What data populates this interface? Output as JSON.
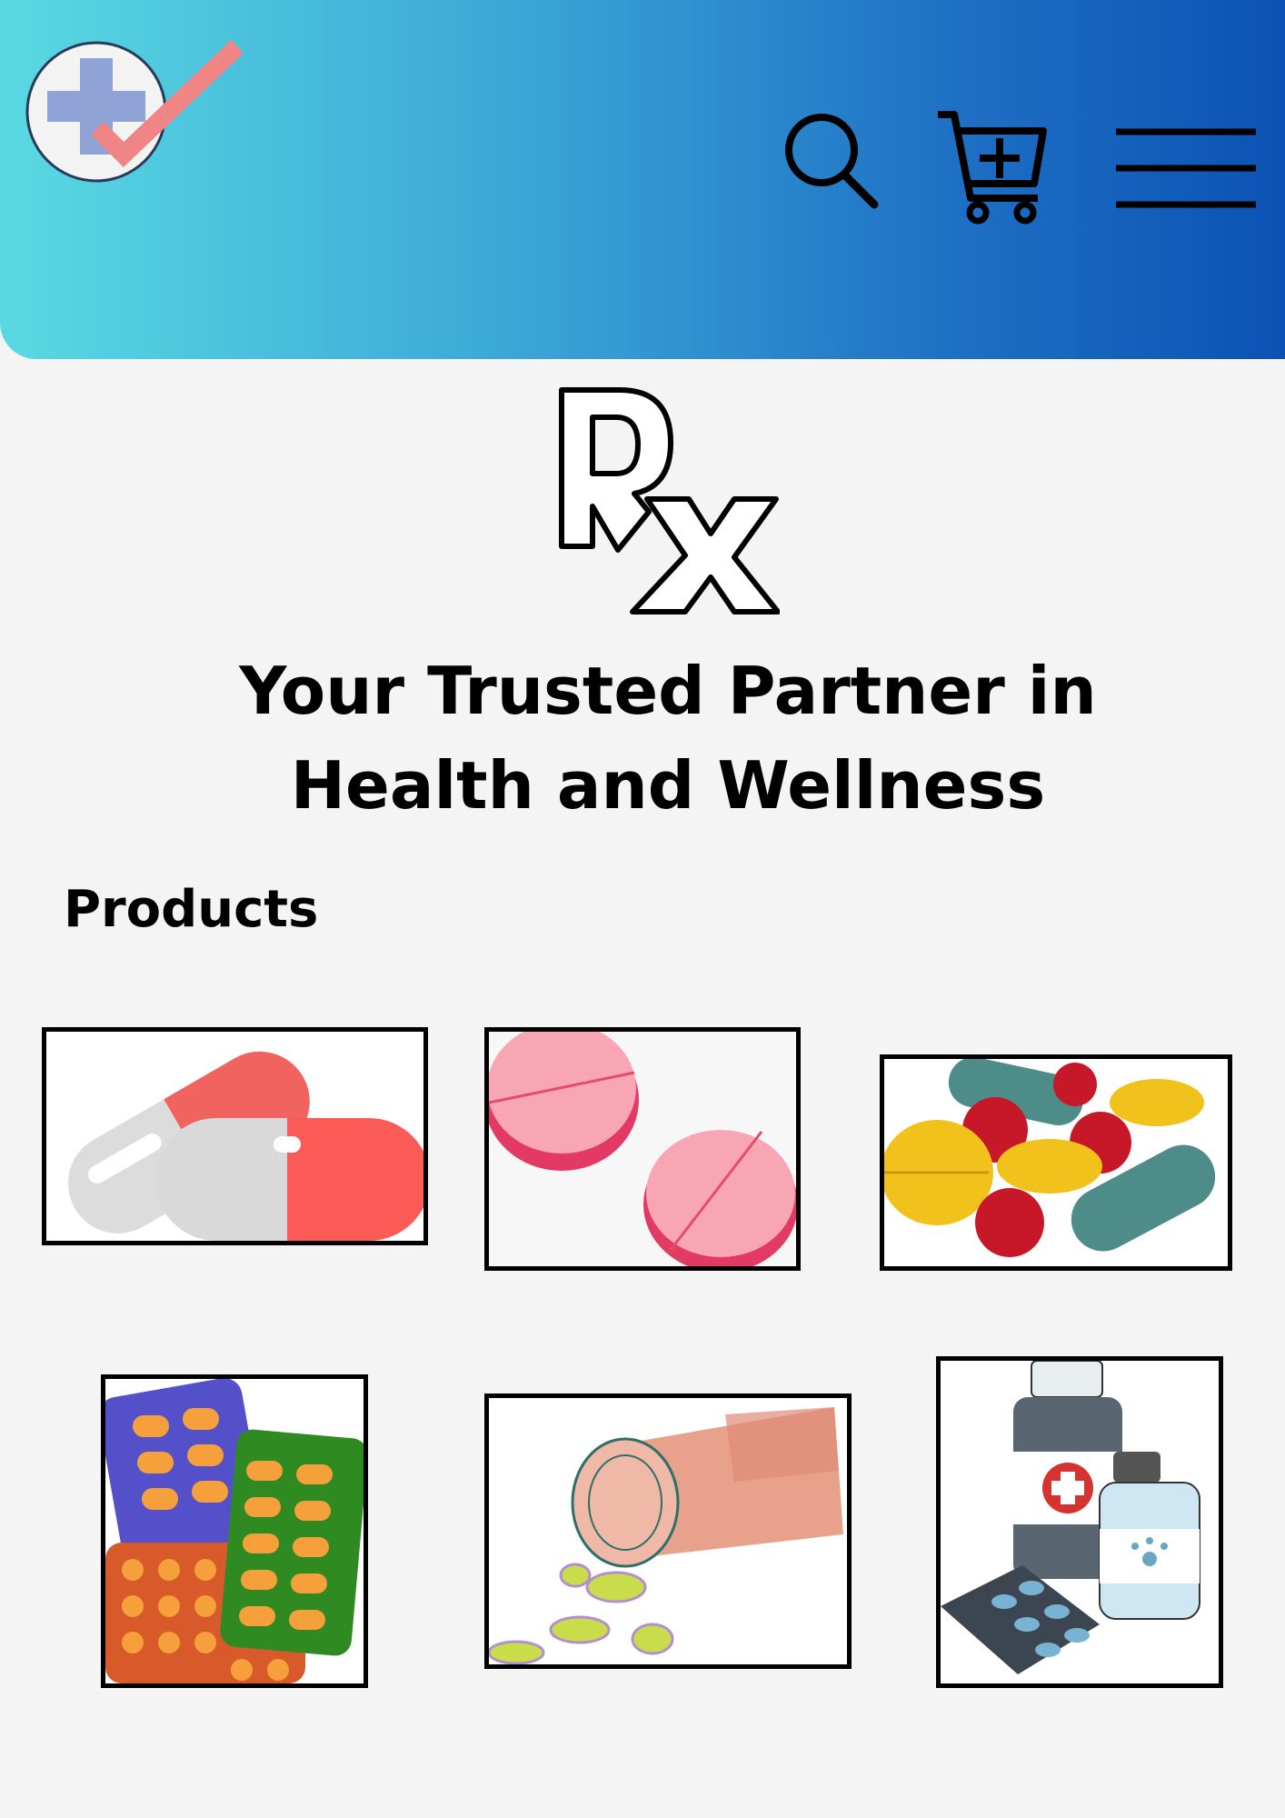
{
  "header": {
    "logo_icon": "pharmacy-cross-check-logo",
    "search_icon": "search-icon",
    "cart_icon": "cart-add-icon",
    "menu_icon": "hamburger-menu-icon",
    "gradient_start": "#5ad9e2",
    "gradient_end": "#0b52b4"
  },
  "hero": {
    "rx_symbol": "Rx",
    "tagline_line1": "Your Trusted Partner in",
    "tagline_line2": "Health and Wellness"
  },
  "products": {
    "heading": "Products",
    "items": [
      {
        "icon": "red-white-capsules-image"
      },
      {
        "icon": "pink-tablets-image"
      },
      {
        "icon": "assorted-pills-image"
      },
      {
        "icon": "blister-packs-image"
      },
      {
        "icon": "spilled-pill-bottle-image"
      },
      {
        "icon": "medicine-bottles-image"
      }
    ]
  }
}
